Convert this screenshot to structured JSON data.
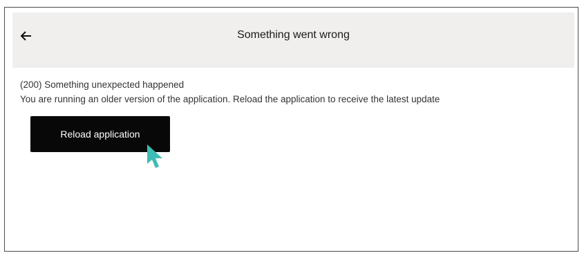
{
  "header": {
    "back_icon": "arrow-left-icon",
    "title": "Something went wrong"
  },
  "error": {
    "code_message": "(200) Something unexpected happened",
    "description": "You are running an older version of the application. Reload the application to receive the latest update"
  },
  "actions": {
    "reload_label": "Reload application"
  },
  "colors": {
    "header_bg": "#f0efed",
    "button_bg": "#080808",
    "cursor": "#3dbdb3"
  },
  "overlay": {
    "cursor_icon": "mouse-pointer-icon"
  }
}
